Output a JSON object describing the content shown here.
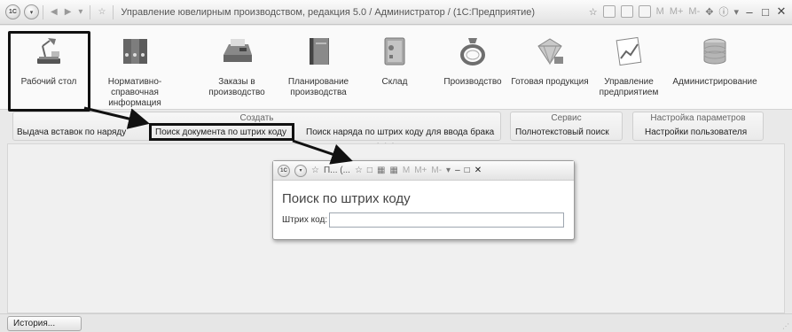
{
  "titlebar": {
    "title": "Управление ювелирным производством, редакция 5.0 / Администратор / (1С:Предприятие)",
    "logo": "1С",
    "m_buttons": [
      "M",
      "M+",
      "M-"
    ]
  },
  "sections": [
    {
      "label": "Рабочий стол",
      "icon": "desk-lamp-icon",
      "color": "#6b6b6b"
    },
    {
      "label": "Нормативно-справочная информация",
      "icon": "binders-icon",
      "color": "#707070"
    },
    {
      "label": "Заказы в производство",
      "icon": "fax-icon",
      "color": "#7a7a7a"
    },
    {
      "label": "Планирование производства",
      "icon": "book-icon",
      "color": "#6e6e6e"
    },
    {
      "label": "Склад",
      "icon": "safe-icon",
      "color": "#9a9a9a"
    },
    {
      "label": "Производство",
      "icon": "ring-icon",
      "color": "#8a8a8a"
    },
    {
      "label": "Готовая продукция",
      "icon": "jewelry-icon",
      "color": "#a0a0a0"
    },
    {
      "label": "Управление предприятием",
      "icon": "chart-icon",
      "color": "#8c8c8c"
    },
    {
      "label": "Администрирование",
      "icon": "database-icon",
      "color": "#a5a5a5"
    }
  ],
  "groups": {
    "create": {
      "title": "Создать",
      "commands": [
        "Выдача вставок по наряду",
        "Поиск документа по штрих коду",
        "Поиск наряда по штрих коду для ввода брака"
      ]
    },
    "service": {
      "title": "Сервис",
      "commands": [
        "Полнотекстовый поиск"
      ]
    },
    "settings": {
      "title": "Настройка параметров",
      "commands": [
        "Настройки пользователя"
      ]
    }
  },
  "dialog": {
    "bar_title": "П... (...",
    "title": "Поиск по штрих коду",
    "field_label": "Штрих код:",
    "field_value": ""
  },
  "footer": {
    "history_label": "История..."
  }
}
